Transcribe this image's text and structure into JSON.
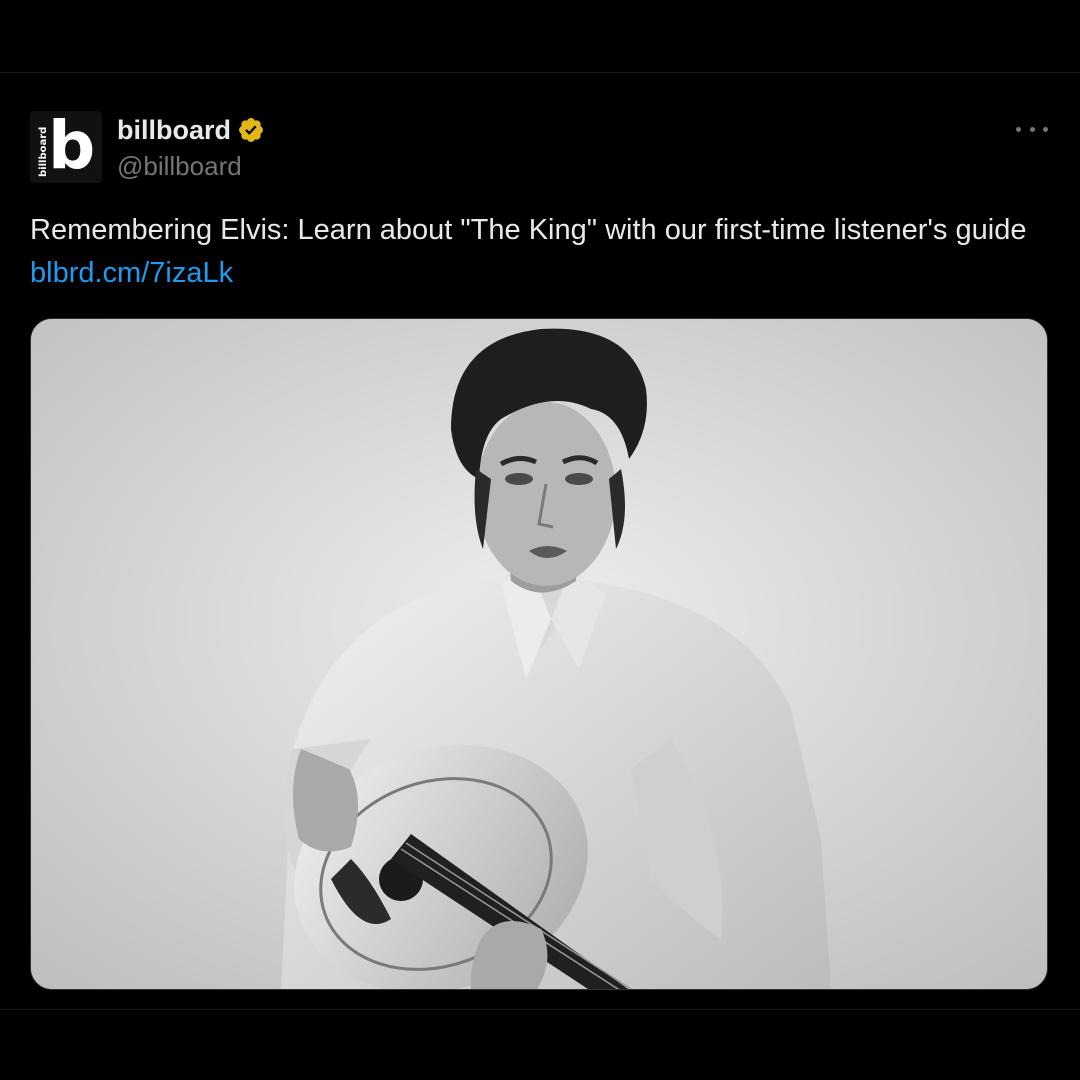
{
  "tweet": {
    "author": {
      "display_name": "billboard",
      "handle": "@billboard",
      "verified": true,
      "verified_color": "#e2b719",
      "avatar_letter": "b",
      "avatar_wordmark": "billboard"
    },
    "text": "Remembering Elvis: Learn about \"The King\" with our first-time listener's guide ",
    "link_text": "blbrd.cm/7izaLk",
    "link_color": "#1d9bf0",
    "more_icon": "more-horizontal-icon",
    "media": {
      "type": "photo",
      "tone": "black-and-white"
    }
  },
  "colors": {
    "background": "#000000",
    "text_primary": "#e7e9ea",
    "text_secondary": "#71767b"
  }
}
